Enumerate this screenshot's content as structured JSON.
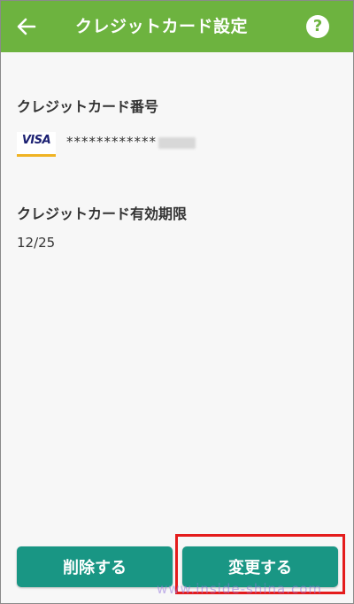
{
  "header": {
    "title": "クレジットカード設定",
    "back_icon": "arrow-left-icon",
    "help_symbol": "?",
    "color": "#6db33f"
  },
  "card": {
    "label": "クレジットカード番号",
    "brand": "VISA",
    "masked_number": "************"
  },
  "expiry": {
    "label": "クレジットカード有効期限",
    "value": "12/25"
  },
  "buttons": {
    "delete_label": "削除する",
    "change_label": "変更する",
    "color": "#199684"
  },
  "highlight_color": "#e41c1c",
  "watermark": "www.inside-shina.com"
}
